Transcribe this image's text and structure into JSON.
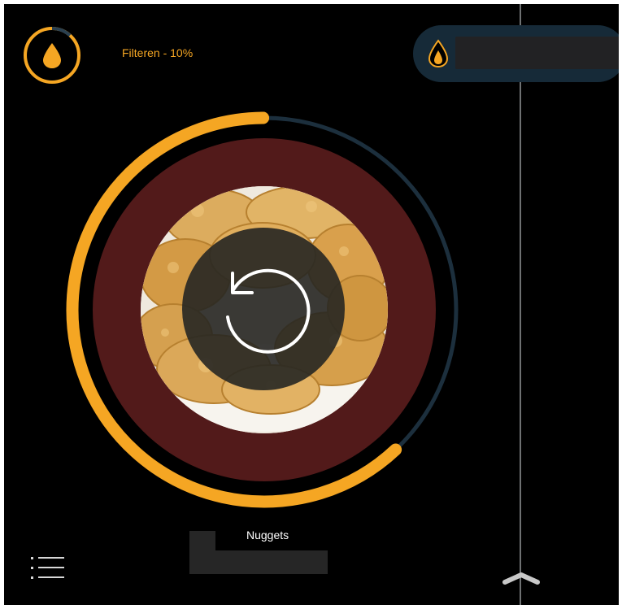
{
  "app": {
    "filter_status": "Filteren - 10%",
    "filter_progress": 0.1,
    "cook_progress_segments": [
      {
        "from": 0.0,
        "to": 0.25
      },
      {
        "from": 0.38,
        "to": 1.0
      }
    ],
    "product": {
      "name": "Nuggets",
      "image": "chicken-nuggets-photo"
    }
  },
  "icons": {
    "filter": "oil-drop-icon",
    "oil": "oil-drop-icon",
    "restart": "restart-icon",
    "menu": "list-menu-icon",
    "expand": "chevron-up-icon"
  },
  "colors": {
    "accent": "#f5a623",
    "track": "#1c2f3d",
    "dial_fill": "#521a1a",
    "pill": "#162a38",
    "background": "#000000"
  }
}
